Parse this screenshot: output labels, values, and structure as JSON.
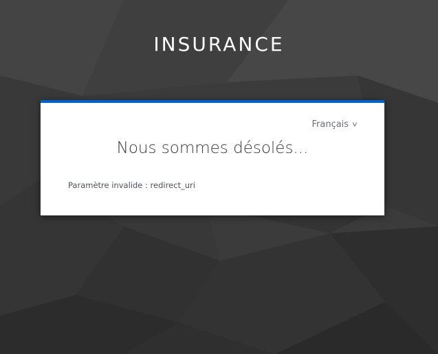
{
  "realm": {
    "title": "INSURANCE"
  },
  "language": {
    "selected": "Français",
    "caret": "v"
  },
  "content": {
    "heading": "Nous sommes désolés...",
    "error_message": "Paramètre invalide : redirect_uri"
  },
  "colors": {
    "accent": "#0066cc",
    "background": "#3a3a3a",
    "card": "#ffffff"
  }
}
